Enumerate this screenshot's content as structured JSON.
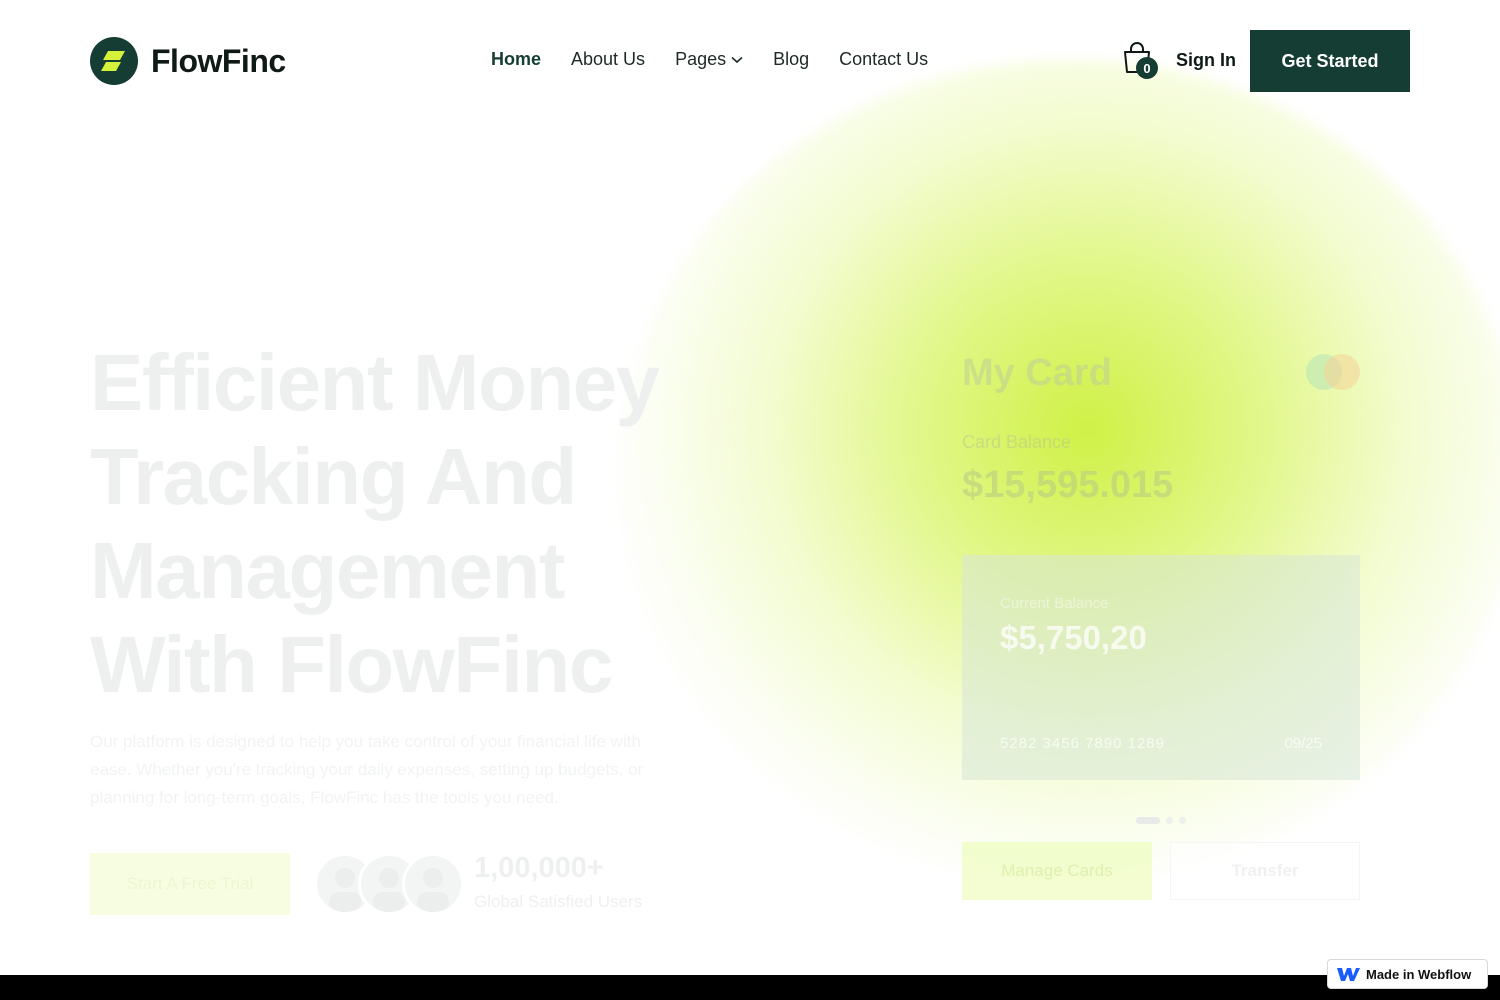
{
  "brand": {
    "name": "FlowFinc",
    "primary": "#163d33",
    "accent": "#cdf03c"
  },
  "nav": {
    "items": [
      {
        "label": "Home",
        "active": true
      },
      {
        "label": "About Us"
      },
      {
        "label": "Pages",
        "has_dropdown": true
      },
      {
        "label": "Blog"
      },
      {
        "label": "Contact Us"
      }
    ]
  },
  "header": {
    "cart_count": "0",
    "signin_label": "Sign In",
    "cta_label": "Get Started"
  },
  "hero": {
    "title_lines": [
      "Efficient Money",
      "Tracking And",
      "Management",
      "With FlowFinc"
    ],
    "description": "Our platform is designed to help you take control of your financial life with ease. Whether you're tracking your daily expenses, setting up budgets, or planning for long-term goals, FlowFinc has the tools you need.",
    "trial_label": "Start A Free Trial",
    "users_count": "1,00,000+",
    "users_label": "Global Satisfied Users"
  },
  "card_widget": {
    "title": "My Card",
    "balance_label": "Card Balance",
    "balance_value": "$15,595.015",
    "current_label": "Current Balance",
    "current_value": "$5,750,20",
    "card_number": "5282 3456 7890 1289",
    "expiry": "09/25",
    "manage_label": "Manage Cards",
    "transfer_label": "Transfer"
  },
  "badge": {
    "label": "Made in Webflow"
  }
}
